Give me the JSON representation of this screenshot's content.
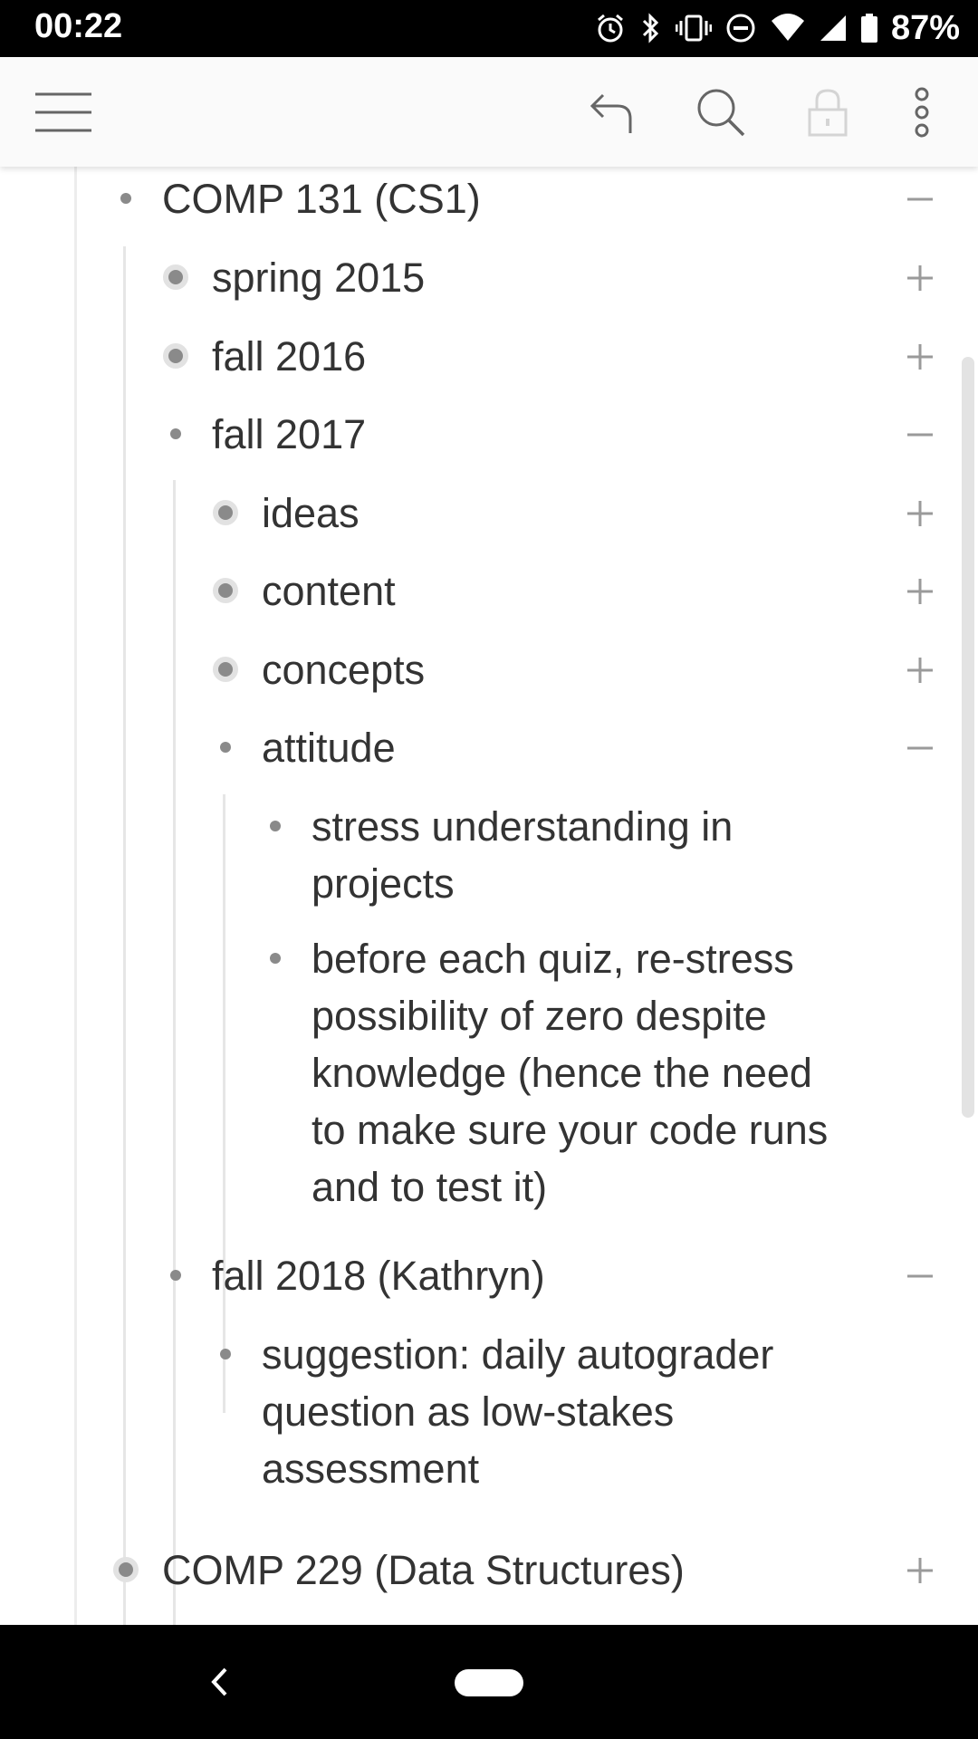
{
  "status_bar": {
    "time": "00:22",
    "battery": "87%"
  },
  "toolbar": {
    "undo": "undo",
    "search": "search",
    "lock": "lock",
    "more": "more"
  },
  "outline": {
    "comp131": "COMP 131 (CS1)",
    "spring2015": "spring 2015",
    "fall2016": "fall 2016",
    "fall2017": "fall 2017",
    "ideas": "ideas",
    "content": "content",
    "concepts": "concepts",
    "attitude": "attitude",
    "stress": "stress understanding in\nprojects",
    "before_quiz": "before each quiz, re-stress\npossibility of zero despite\nknowledge (hence the need\nto make sure your code runs\nand to test it)",
    "fall2018": "fall 2018 (Kathryn)",
    "suggestion": "suggestion: daily autograder\nquestion as low-stakes\nassessment",
    "comp229": "COMP 229 (Data Structures)"
  },
  "colors": {
    "text": "#333333",
    "bullet": "#8a8a8a",
    "guide": "#e6e6e6",
    "toggle": "#9a9a9a"
  }
}
